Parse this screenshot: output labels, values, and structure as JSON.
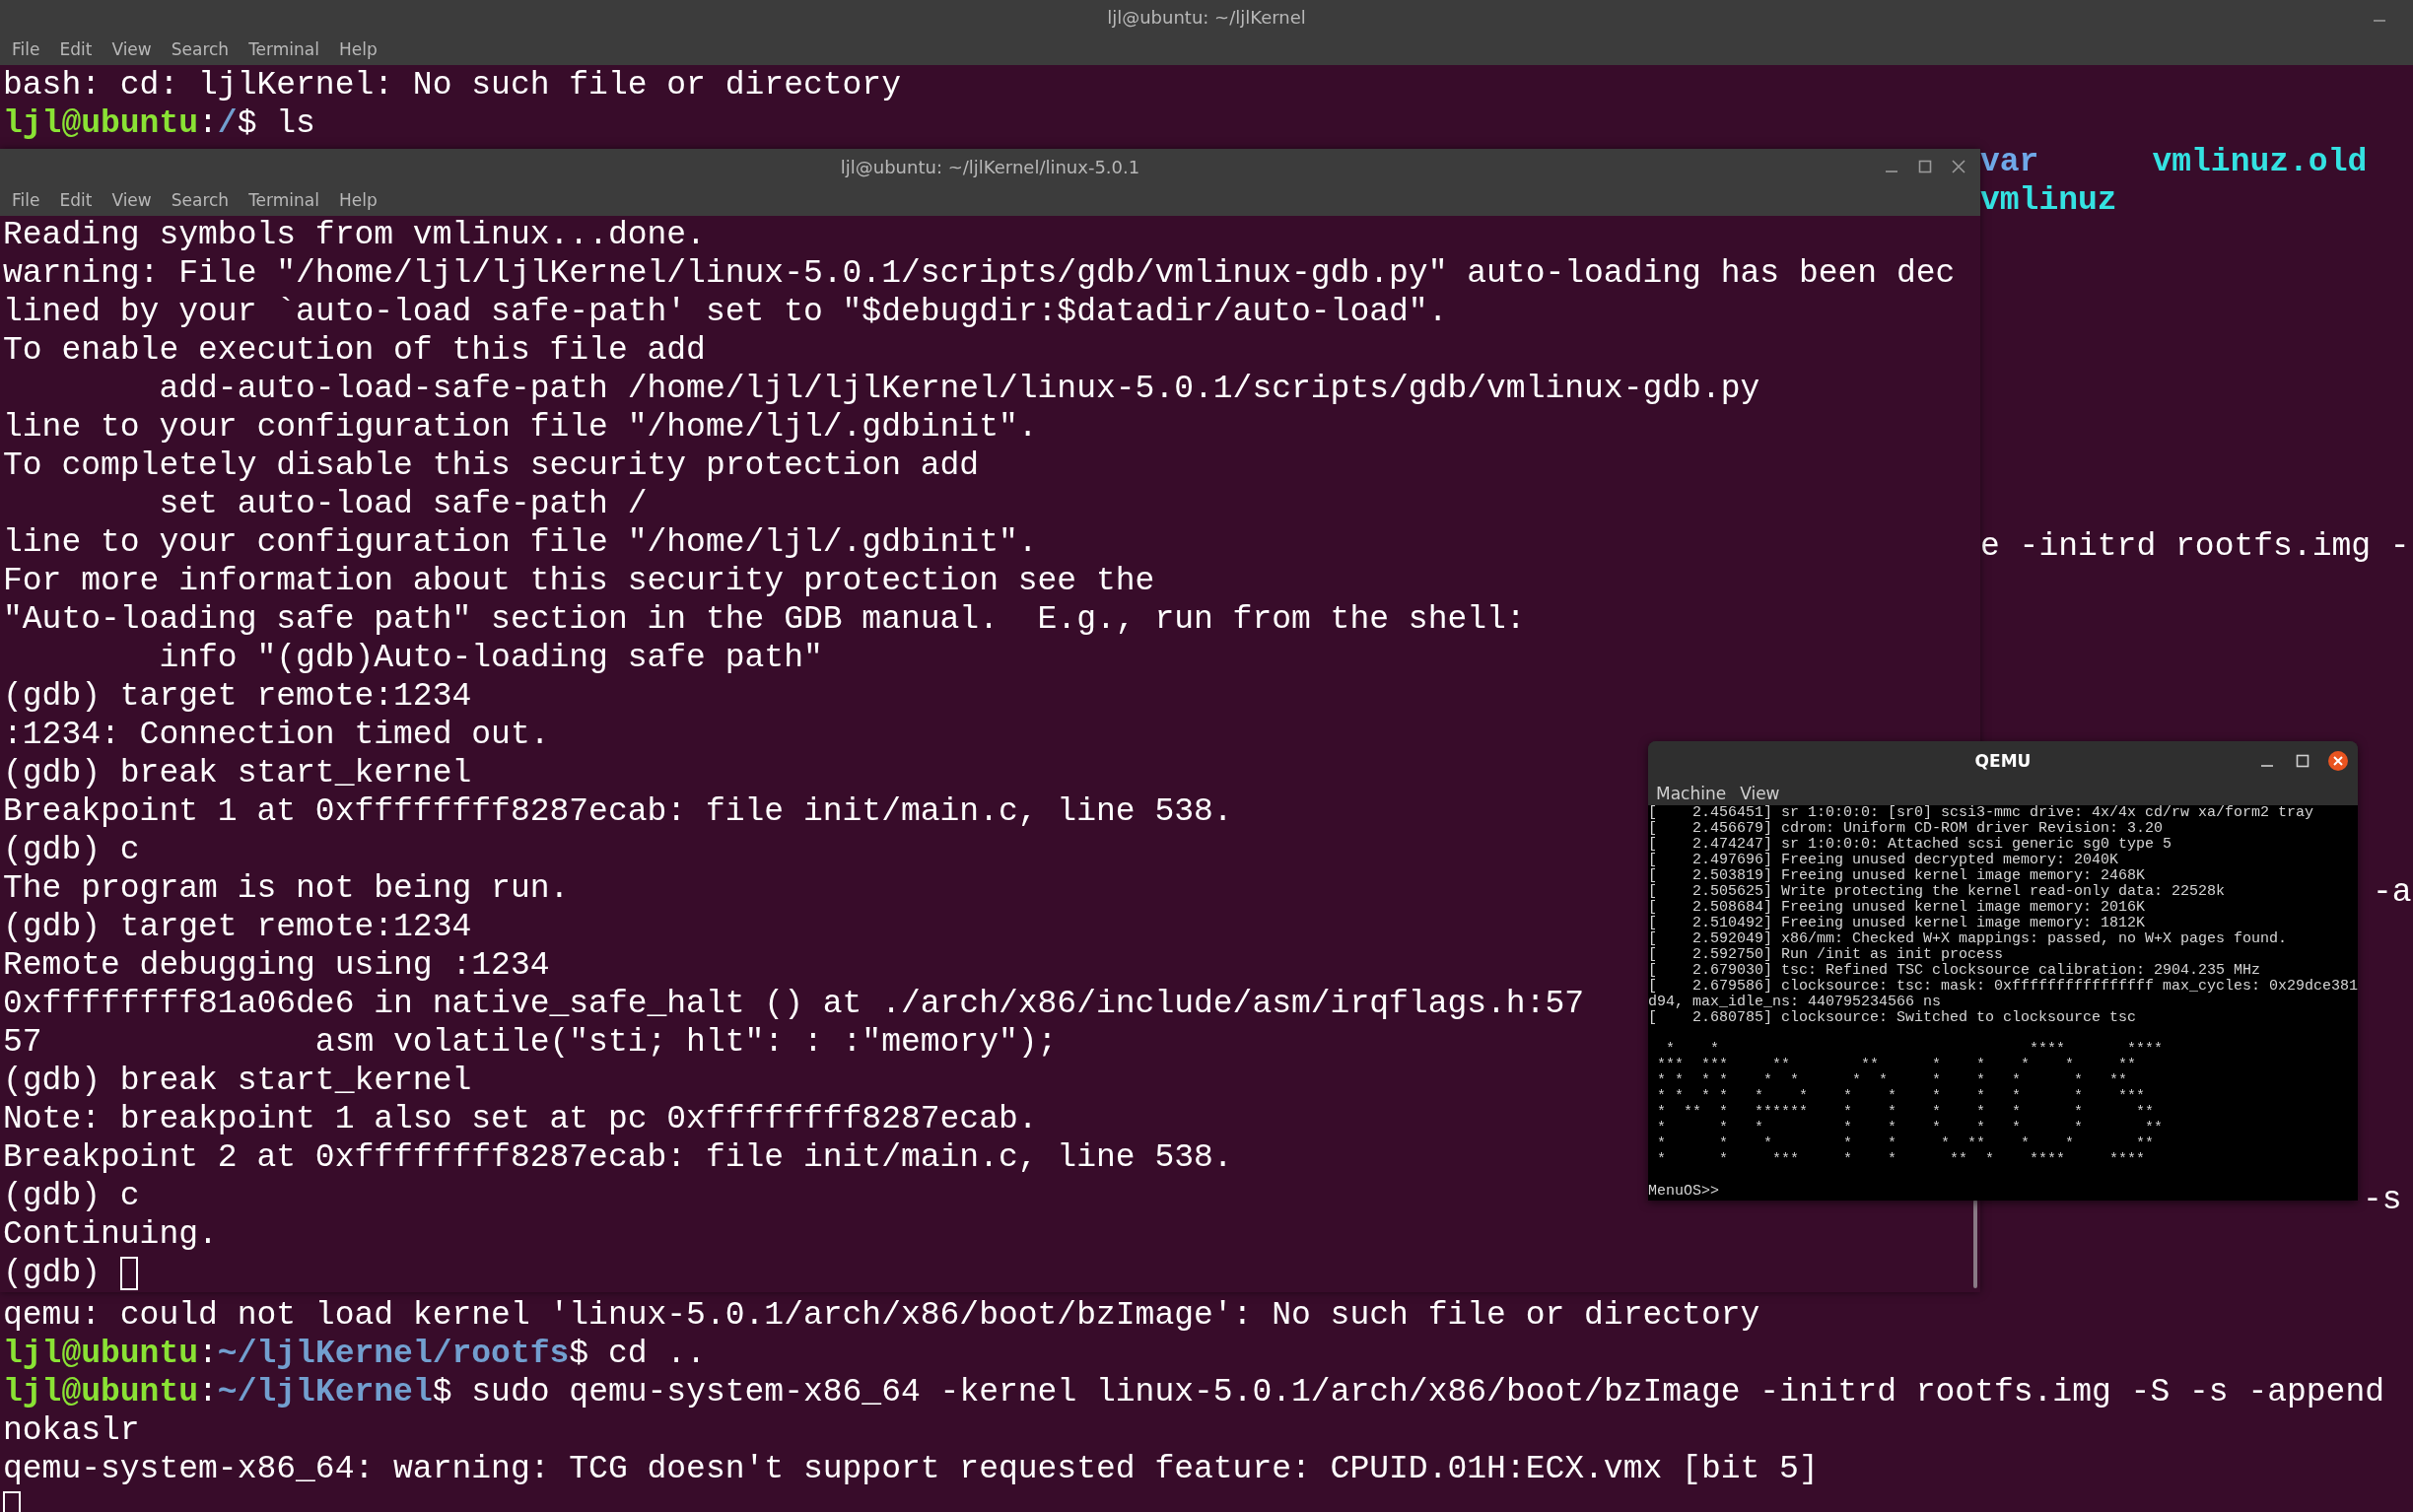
{
  "back_terminal": {
    "title": "ljl@ubuntu: ~/ljlKernel",
    "menu": [
      "File",
      "Edit",
      "View",
      "Search",
      "Terminal",
      "Help"
    ],
    "lines_top": [
      {
        "cursor": false,
        "segments": [
          {
            "kind": "plain",
            "text": "bash: cd: ljlKernel: No such file or directory"
          }
        ]
      },
      {
        "cursor": false,
        "segments": [
          {
            "kind": "user",
            "text": "ljl@ubuntu"
          },
          {
            "kind": "plain",
            "text": ":"
          },
          {
            "kind": "path",
            "text": "/"
          },
          {
            "kind": "plain",
            "text": "$ ls"
          }
        ]
      }
    ],
    "fragments": [
      {
        "segments": [
          {
            "kind": "dir",
            "text": "var"
          },
          {
            "kind": "link",
            "text": "vmlinuz.old"
          }
        ]
      },
      {
        "segments": [
          {
            "kind": "link",
            "text": "vmlinuz"
          }
        ]
      },
      {
        "segments": [
          {
            "kind": "plain",
            "text": "e -initrd rootfs.img -"
          }
        ]
      },
      {
        "segments": [
          {
            "kind": "plain",
            "text": "-a"
          }
        ]
      },
      {
        "segments": [
          {
            "kind": "plain",
            "text": "-s"
          }
        ]
      }
    ],
    "lines_bottom": [
      {
        "cursor": false,
        "segments": [
          {
            "kind": "plain",
            "text": "qemu: could not load kernel 'linux-5.0.1/arch/x86/boot/bzImage': No such file or directory"
          }
        ]
      },
      {
        "cursor": false,
        "segments": [
          {
            "kind": "user",
            "text": "ljl@ubuntu"
          },
          {
            "kind": "plain",
            "text": ":"
          },
          {
            "kind": "path",
            "text": "~/ljlKernel/rootfs"
          },
          {
            "kind": "plain",
            "text": "$ cd .."
          }
        ]
      },
      {
        "cursor": false,
        "segments": [
          {
            "kind": "user",
            "text": "ljl@ubuntu"
          },
          {
            "kind": "plain",
            "text": ":"
          },
          {
            "kind": "path",
            "text": "~/ljlKernel"
          },
          {
            "kind": "plain",
            "text": "$ sudo qemu-system-x86_64 -kernel linux-5.0.1/arch/x86/boot/bzImage -initrd rootfs.img -S -s -append"
          }
        ]
      },
      {
        "cursor": false,
        "segments": [
          {
            "kind": "plain",
            "text": "nokaslr"
          }
        ]
      },
      {
        "cursor": false,
        "segments": [
          {
            "kind": "plain",
            "text": "qemu-system-x86_64: warning: TCG doesn't support requested feature: CPUID.01H:ECX.vmx [bit 5]"
          }
        ]
      },
      {
        "cursor": true
      }
    ]
  },
  "front_terminal": {
    "title": "ljl@ubuntu: ~/ljlKernel/linux-5.0.1",
    "menu": [
      "File",
      "Edit",
      "View",
      "Search",
      "Terminal",
      "Help"
    ],
    "lines": [
      "Reading symbols from vmlinux...done.",
      "warning: File \"/home/ljl/ljlKernel/linux-5.0.1/scripts/gdb/vmlinux-gdb.py\" auto-loading has been dec",
      "lined by your `auto-load safe-path' set to \"$debugdir:$datadir/auto-load\".",
      "To enable execution of this file add",
      "        add-auto-load-safe-path /home/ljl/ljlKernel/linux-5.0.1/scripts/gdb/vmlinux-gdb.py",
      "line to your configuration file \"/home/ljl/.gdbinit\".",
      "To completely disable this security protection add",
      "        set auto-load safe-path /",
      "line to your configuration file \"/home/ljl/.gdbinit\".",
      "For more information about this security protection see the",
      "\"Auto-loading safe path\" section in the GDB manual.  E.g., run from the shell:",
      "        info \"(gdb)Auto-loading safe path\"",
      "(gdb) target remote:1234",
      ":1234: Connection timed out.",
      "(gdb) break start_kernel",
      "Breakpoint 1 at 0xffffffff8287ecab: file init/main.c, line 538.",
      "(gdb) c",
      "The program is not being run.",
      "(gdb) target remote:1234",
      "Remote debugging using :1234",
      "0xffffffff81a06de6 in native_safe_halt () at ./arch/x86/include/asm/irqflags.h:57",
      "57              asm volatile(\"sti; hlt\": : :\"memory\");",
      "(gdb) break start_kernel",
      "Note: breakpoint 1 also set at pc 0xffffffff8287ecab.",
      "Breakpoint 2 at 0xffffffff8287ecab: file init/main.c, line 538.",
      "(gdb) c",
      "Continuing."
    ],
    "input": {
      "text": "(gdb)",
      "cursor": true
    }
  },
  "qemu": {
    "title": "QEMU",
    "menu": [
      "Machine",
      "View"
    ],
    "log_lines": [
      "[    2.456451] sr 1:0:0:0: [sr0] scsi3-mmc drive: 4x/4x cd/rw xa/form2 tray",
      "[    2.456679] cdrom: Uniform CD-ROM driver Revision: 3.20",
      "[    2.474247] sr 1:0:0:0: Attached scsi generic sg0 type 5",
      "[    2.497696] Freeing unused decrypted memory: 2040K",
      "[    2.503819] Freeing unused kernel image memory: 2468K",
      "[    2.505625] Write protecting the kernel read-only data: 22528k",
      "[    2.508684] Freeing unused kernel image memory: 2016K",
      "[    2.510492] Freeing unused kernel image memory: 1812K",
      "[    2.592049] x86/mm: Checked W+X mappings: passed, no W+X pages found.",
      "[    2.592750] Run /init as init process",
      "[    2.679030] tsc: Refined TSC clocksource calibration: 2904.235 MHz",
      "[    2.679586] clocksource: tsc: mask: 0xffffffffffffffff max_cycles: 0x29dce381",
      "d94, max_idle_ns: 440795234566 ns",
      "[    2.680785] clocksource: Switched to clocksource tsc"
    ],
    "banner": "  *    *                                   ****       ****\n ***  ***     **        **      *    *    *    *     **\n * *  * *    *  *      *  *     *    *   *      *   **\n * *  * *   *    *    *    *    *    *   *      *    ***\n *  **  *   ******    *    *    *    *   *      *      **\n *      *   *         *    *    *    *   *      *       **\n *      *    *        *    *     *  **    *    *       **\n *      *     ***     *    *      **  *    ****     ****",
    "prompt": "MenuOS>>"
  }
}
